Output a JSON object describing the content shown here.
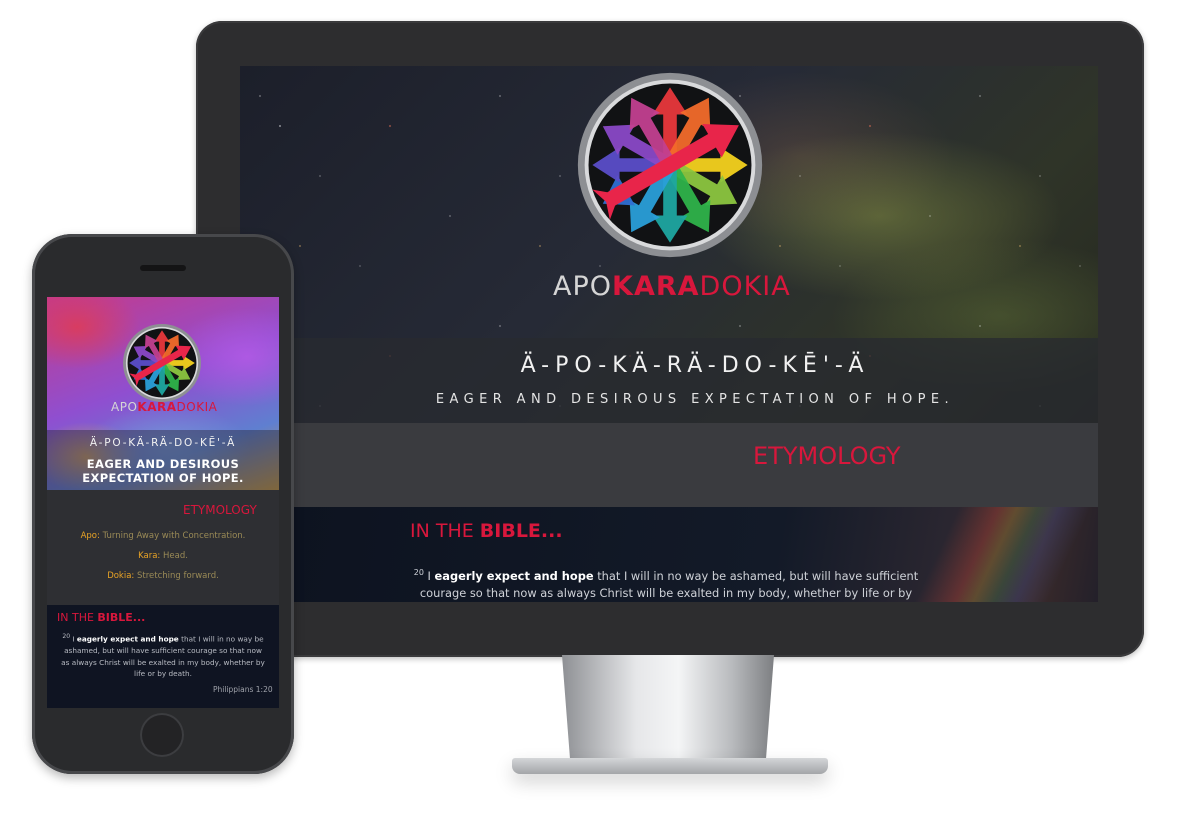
{
  "desktop": {
    "brand": {
      "part1": "APO",
      "part2": "KARA",
      "part3": "DOKIA"
    },
    "pronunciation": "Ä-PO-KÄ-RÄ-DO-KĒ'-Ä",
    "meaning": "EAGER AND DESIROUS EXPECTATION OF HOPE.",
    "etymology_title": "ETYMOLOGY",
    "bible_title_prefix": "IN THE ",
    "bible_title_bold": "BIBLE...",
    "verse": {
      "number": "20",
      "pre": " I ",
      "emphasis": "eagerly expect and hope",
      "post": " that I will in no way be ashamed, but will have sufficient courage so that now as always Christ will be exalted in my body, whether by life or by death."
    }
  },
  "phone": {
    "brand": {
      "part1": "APO",
      "part2": "KARA",
      "part3": "DOKIA"
    },
    "pronunciation": "Ä-PO-KÄ-RÄ-DO-KĒ'-Ä",
    "meaning_line1": "EAGER AND DESIROUS",
    "meaning_line2": "EXPECTATION OF HOPE.",
    "etymology_title": "ETYMOLOGY",
    "definitions": [
      {
        "term": "Apo:",
        "desc": " Turning Away with Concentration."
      },
      {
        "term": "Kara:",
        "desc": " Head."
      },
      {
        "term": "Dokia:",
        "desc": " Stretching forward."
      }
    ],
    "bible_title_prefix": "IN THE ",
    "bible_title_bold": "BIBLE...",
    "verse": {
      "number": "20",
      "pre": " I ",
      "emphasis": "eagerly expect and hope",
      "post": " that I will in no way be ashamed, but will have sufficient courage so that now as always Christ will be exalted in my body, whether by life or by death."
    },
    "reference": "Philippians 1:20"
  },
  "colors": {
    "accent_red": "#d8173c",
    "gold": "#e8a326",
    "monitor_bezel": "#2d2d2f"
  }
}
